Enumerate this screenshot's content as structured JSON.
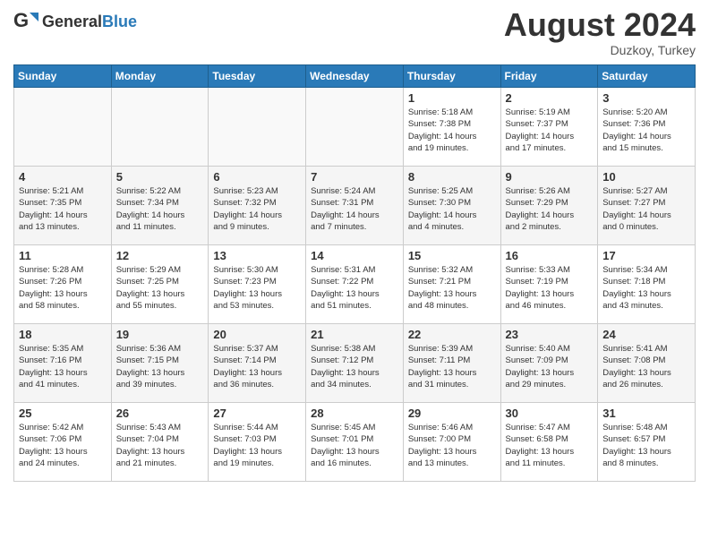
{
  "header": {
    "logo_general": "General",
    "logo_blue": "Blue",
    "month_year": "August 2024",
    "location": "Duzkoy, Turkey"
  },
  "days_of_week": [
    "Sunday",
    "Monday",
    "Tuesday",
    "Wednesday",
    "Thursday",
    "Friday",
    "Saturday"
  ],
  "weeks": [
    [
      {
        "day": "",
        "detail": ""
      },
      {
        "day": "",
        "detail": ""
      },
      {
        "day": "",
        "detail": ""
      },
      {
        "day": "",
        "detail": ""
      },
      {
        "day": "1",
        "detail": "Sunrise: 5:18 AM\nSunset: 7:38 PM\nDaylight: 14 hours\nand 19 minutes."
      },
      {
        "day": "2",
        "detail": "Sunrise: 5:19 AM\nSunset: 7:37 PM\nDaylight: 14 hours\nand 17 minutes."
      },
      {
        "day": "3",
        "detail": "Sunrise: 5:20 AM\nSunset: 7:36 PM\nDaylight: 14 hours\nand 15 minutes."
      }
    ],
    [
      {
        "day": "4",
        "detail": "Sunrise: 5:21 AM\nSunset: 7:35 PM\nDaylight: 14 hours\nand 13 minutes."
      },
      {
        "day": "5",
        "detail": "Sunrise: 5:22 AM\nSunset: 7:34 PM\nDaylight: 14 hours\nand 11 minutes."
      },
      {
        "day": "6",
        "detail": "Sunrise: 5:23 AM\nSunset: 7:32 PM\nDaylight: 14 hours\nand 9 minutes."
      },
      {
        "day": "7",
        "detail": "Sunrise: 5:24 AM\nSunset: 7:31 PM\nDaylight: 14 hours\nand 7 minutes."
      },
      {
        "day": "8",
        "detail": "Sunrise: 5:25 AM\nSunset: 7:30 PM\nDaylight: 14 hours\nand 4 minutes."
      },
      {
        "day": "9",
        "detail": "Sunrise: 5:26 AM\nSunset: 7:29 PM\nDaylight: 14 hours\nand 2 minutes."
      },
      {
        "day": "10",
        "detail": "Sunrise: 5:27 AM\nSunset: 7:27 PM\nDaylight: 14 hours\nand 0 minutes."
      }
    ],
    [
      {
        "day": "11",
        "detail": "Sunrise: 5:28 AM\nSunset: 7:26 PM\nDaylight: 13 hours\nand 58 minutes."
      },
      {
        "day": "12",
        "detail": "Sunrise: 5:29 AM\nSunset: 7:25 PM\nDaylight: 13 hours\nand 55 minutes."
      },
      {
        "day": "13",
        "detail": "Sunrise: 5:30 AM\nSunset: 7:23 PM\nDaylight: 13 hours\nand 53 minutes."
      },
      {
        "day": "14",
        "detail": "Sunrise: 5:31 AM\nSunset: 7:22 PM\nDaylight: 13 hours\nand 51 minutes."
      },
      {
        "day": "15",
        "detail": "Sunrise: 5:32 AM\nSunset: 7:21 PM\nDaylight: 13 hours\nand 48 minutes."
      },
      {
        "day": "16",
        "detail": "Sunrise: 5:33 AM\nSunset: 7:19 PM\nDaylight: 13 hours\nand 46 minutes."
      },
      {
        "day": "17",
        "detail": "Sunrise: 5:34 AM\nSunset: 7:18 PM\nDaylight: 13 hours\nand 43 minutes."
      }
    ],
    [
      {
        "day": "18",
        "detail": "Sunrise: 5:35 AM\nSunset: 7:16 PM\nDaylight: 13 hours\nand 41 minutes."
      },
      {
        "day": "19",
        "detail": "Sunrise: 5:36 AM\nSunset: 7:15 PM\nDaylight: 13 hours\nand 39 minutes."
      },
      {
        "day": "20",
        "detail": "Sunrise: 5:37 AM\nSunset: 7:14 PM\nDaylight: 13 hours\nand 36 minutes."
      },
      {
        "day": "21",
        "detail": "Sunrise: 5:38 AM\nSunset: 7:12 PM\nDaylight: 13 hours\nand 34 minutes."
      },
      {
        "day": "22",
        "detail": "Sunrise: 5:39 AM\nSunset: 7:11 PM\nDaylight: 13 hours\nand 31 minutes."
      },
      {
        "day": "23",
        "detail": "Sunrise: 5:40 AM\nSunset: 7:09 PM\nDaylight: 13 hours\nand 29 minutes."
      },
      {
        "day": "24",
        "detail": "Sunrise: 5:41 AM\nSunset: 7:08 PM\nDaylight: 13 hours\nand 26 minutes."
      }
    ],
    [
      {
        "day": "25",
        "detail": "Sunrise: 5:42 AM\nSunset: 7:06 PM\nDaylight: 13 hours\nand 24 minutes."
      },
      {
        "day": "26",
        "detail": "Sunrise: 5:43 AM\nSunset: 7:04 PM\nDaylight: 13 hours\nand 21 minutes."
      },
      {
        "day": "27",
        "detail": "Sunrise: 5:44 AM\nSunset: 7:03 PM\nDaylight: 13 hours\nand 19 minutes."
      },
      {
        "day": "28",
        "detail": "Sunrise: 5:45 AM\nSunset: 7:01 PM\nDaylight: 13 hours\nand 16 minutes."
      },
      {
        "day": "29",
        "detail": "Sunrise: 5:46 AM\nSunset: 7:00 PM\nDaylight: 13 hours\nand 13 minutes."
      },
      {
        "day": "30",
        "detail": "Sunrise: 5:47 AM\nSunset: 6:58 PM\nDaylight: 13 hours\nand 11 minutes."
      },
      {
        "day": "31",
        "detail": "Sunrise: 5:48 AM\nSunset: 6:57 PM\nDaylight: 13 hours\nand 8 minutes."
      }
    ]
  ]
}
